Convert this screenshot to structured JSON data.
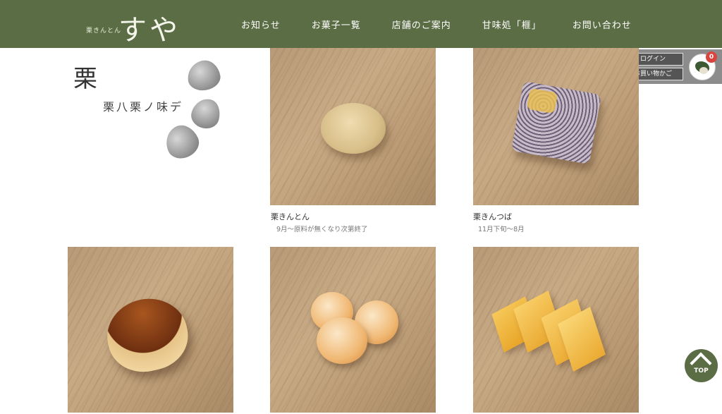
{
  "header": {
    "logo_sub": "栗きんとん",
    "logo_main": "すや",
    "nav": [
      "お知らせ",
      "お菓子一覧",
      "店舗のご案内",
      "甘味処「榧」",
      "お問い合わせ"
    ]
  },
  "account": {
    "login_label": "ログイン",
    "cart_label": "お買い物かご",
    "cart_count": "0"
  },
  "category": {
    "title": "栗",
    "subtitle": "栗八栗ノ味デ"
  },
  "products": [
    {
      "name": "栗きんとん",
      "note": "9月～原料が無くなり次第終了"
    },
    {
      "name": "栗きんつば",
      "note": "11月下旬～8月"
    },
    {
      "name": "",
      "note": ""
    },
    {
      "name": "",
      "note": ""
    },
    {
      "name": "",
      "note": ""
    }
  ],
  "top_button": {
    "label": "TOP"
  },
  "colors": {
    "header_bg": "#5b6d45",
    "badge": "#d9443f"
  }
}
